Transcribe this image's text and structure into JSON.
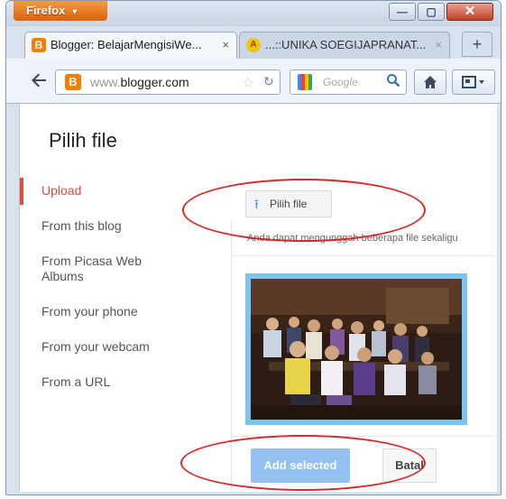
{
  "browser": {
    "menu_label": "Firefox",
    "menu_arrow": "▼",
    "window_controls": {
      "minimize": "—",
      "maximize": "▢",
      "close": "✕"
    },
    "tabs": [
      {
        "title": "Blogger: BelajarMengisiWe...",
        "icon": "blogger-icon",
        "icon_glyph": "B",
        "close": "×"
      },
      {
        "title": "...::UNIKA SOEGIJAPRANAT...",
        "icon": "unika-icon",
        "icon_glyph": "A",
        "close": "×"
      }
    ],
    "new_tab": "+",
    "url_prefix": "www.",
    "url_domain": "blogger.com",
    "search_placeholder": "Google",
    "icons": {
      "back": "back-arrow-icon",
      "home": "home-icon",
      "bookmarks": "bookmarks-icon",
      "search": "magnifier-icon"
    }
  },
  "dialog": {
    "title": "Pilih file",
    "sidebar": [
      {
        "label": "Upload",
        "active": true
      },
      {
        "label": "From this blog",
        "active": false
      },
      {
        "label": "From Picasa Web Albums",
        "active": false
      },
      {
        "label": "From your phone",
        "active": false
      },
      {
        "label": "From your webcam",
        "active": false
      },
      {
        "label": "From a URL",
        "active": false
      }
    ],
    "choose_file_button": "Pilih file",
    "hint": "Anda dapat mengunggah beberapa file sekaligu",
    "add_button": "Add selected",
    "cancel_button": "Batal"
  },
  "colors": {
    "accent_red": "#dd4b39",
    "primary_blue": "#94c1f2",
    "thumb_border": "#7cc3ef",
    "annotation": "#d62828"
  }
}
